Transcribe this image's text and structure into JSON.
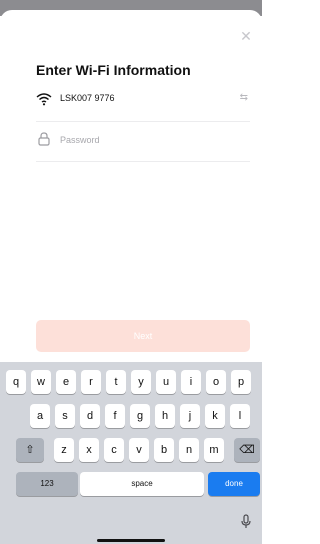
{
  "dialog": {
    "title": "Enter Wi-Fi Information",
    "ssid": "LSK007 9776",
    "password_placeholder": "Password",
    "next_label": "Next"
  },
  "keyboard": {
    "row1": [
      "q",
      "w",
      "e",
      "r",
      "t",
      "y",
      "u",
      "i",
      "o",
      "p"
    ],
    "row2": [
      "a",
      "s",
      "d",
      "f",
      "g",
      "h",
      "j",
      "k",
      "l"
    ],
    "row3": [
      "z",
      "x",
      "c",
      "v",
      "b",
      "n",
      "m"
    ],
    "numbers_label": "123",
    "space_label": "space",
    "done_label": "done"
  },
  "icons": {
    "close": "close-icon",
    "wifi": "wifi-icon",
    "swap": "swap-icon",
    "lock": "lock-icon",
    "shift": "shift-icon",
    "backspace": "backspace-icon",
    "mic": "microphone-icon"
  },
  "colors": {
    "next_button_bg": "#fde0d9",
    "done_key_bg": "#1a7cf0",
    "keyboard_bg": "#d2d5db"
  }
}
